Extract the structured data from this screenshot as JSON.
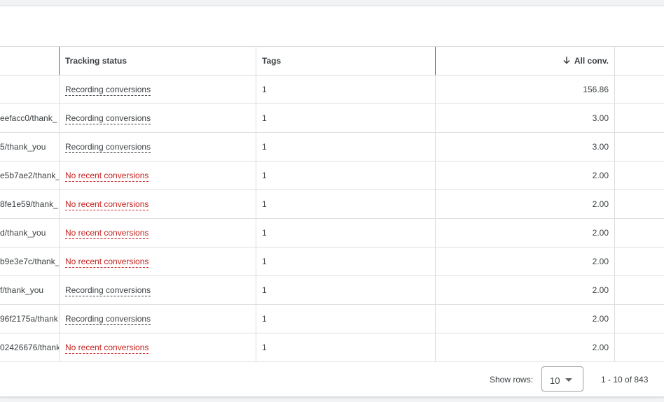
{
  "table": {
    "headers": {
      "tracking_status": "Tracking status",
      "tags": "Tags",
      "all_conv": "All conv."
    },
    "rows": [
      {
        "action": "",
        "status": "Recording conversions",
        "status_type": "ok",
        "tags": "1",
        "all_conv": "156.86"
      },
      {
        "action": "eefacc0/thank_",
        "status": "Recording conversions",
        "status_type": "ok",
        "tags": "1",
        "all_conv": "3.00"
      },
      {
        "action": "5/thank_you",
        "status": "Recording conversions",
        "status_type": "ok",
        "tags": "1",
        "all_conv": "3.00"
      },
      {
        "action": "e5b7ae2/thank_",
        "status": "No recent conversions",
        "status_type": "warn",
        "tags": "1",
        "all_conv": "2.00"
      },
      {
        "action": "8fe1e59/thank_",
        "status": "No recent conversions",
        "status_type": "warn",
        "tags": "1",
        "all_conv": "2.00"
      },
      {
        "action": "d/thank_you",
        "status": "No recent conversions",
        "status_type": "warn",
        "tags": "1",
        "all_conv": "2.00"
      },
      {
        "action": "b9e3e7c/thank_",
        "status": "No recent conversions",
        "status_type": "warn",
        "tags": "1",
        "all_conv": "2.00"
      },
      {
        "action": "f/thank_you",
        "status": "Recording conversions",
        "status_type": "ok",
        "tags": "1",
        "all_conv": "2.00"
      },
      {
        "action": "96f2175a/thank",
        "status": "Recording conversions",
        "status_type": "ok",
        "tags": "1",
        "all_conv": "2.00"
      },
      {
        "action": "02426676/thank",
        "status": "No recent conversions",
        "status_type": "warn",
        "tags": "1",
        "all_conv": "2.00"
      }
    ]
  },
  "footer": {
    "show_rows_label": "Show rows:",
    "rows_value": "10",
    "pagination": "1 - 10 of 843"
  },
  "icons": {
    "sort": "arrow-down-icon",
    "select": "caret-down-icon"
  },
  "colors": {
    "ok_status": "#3c4043",
    "warn_status": "#c5221f",
    "border": "#dadce0"
  }
}
